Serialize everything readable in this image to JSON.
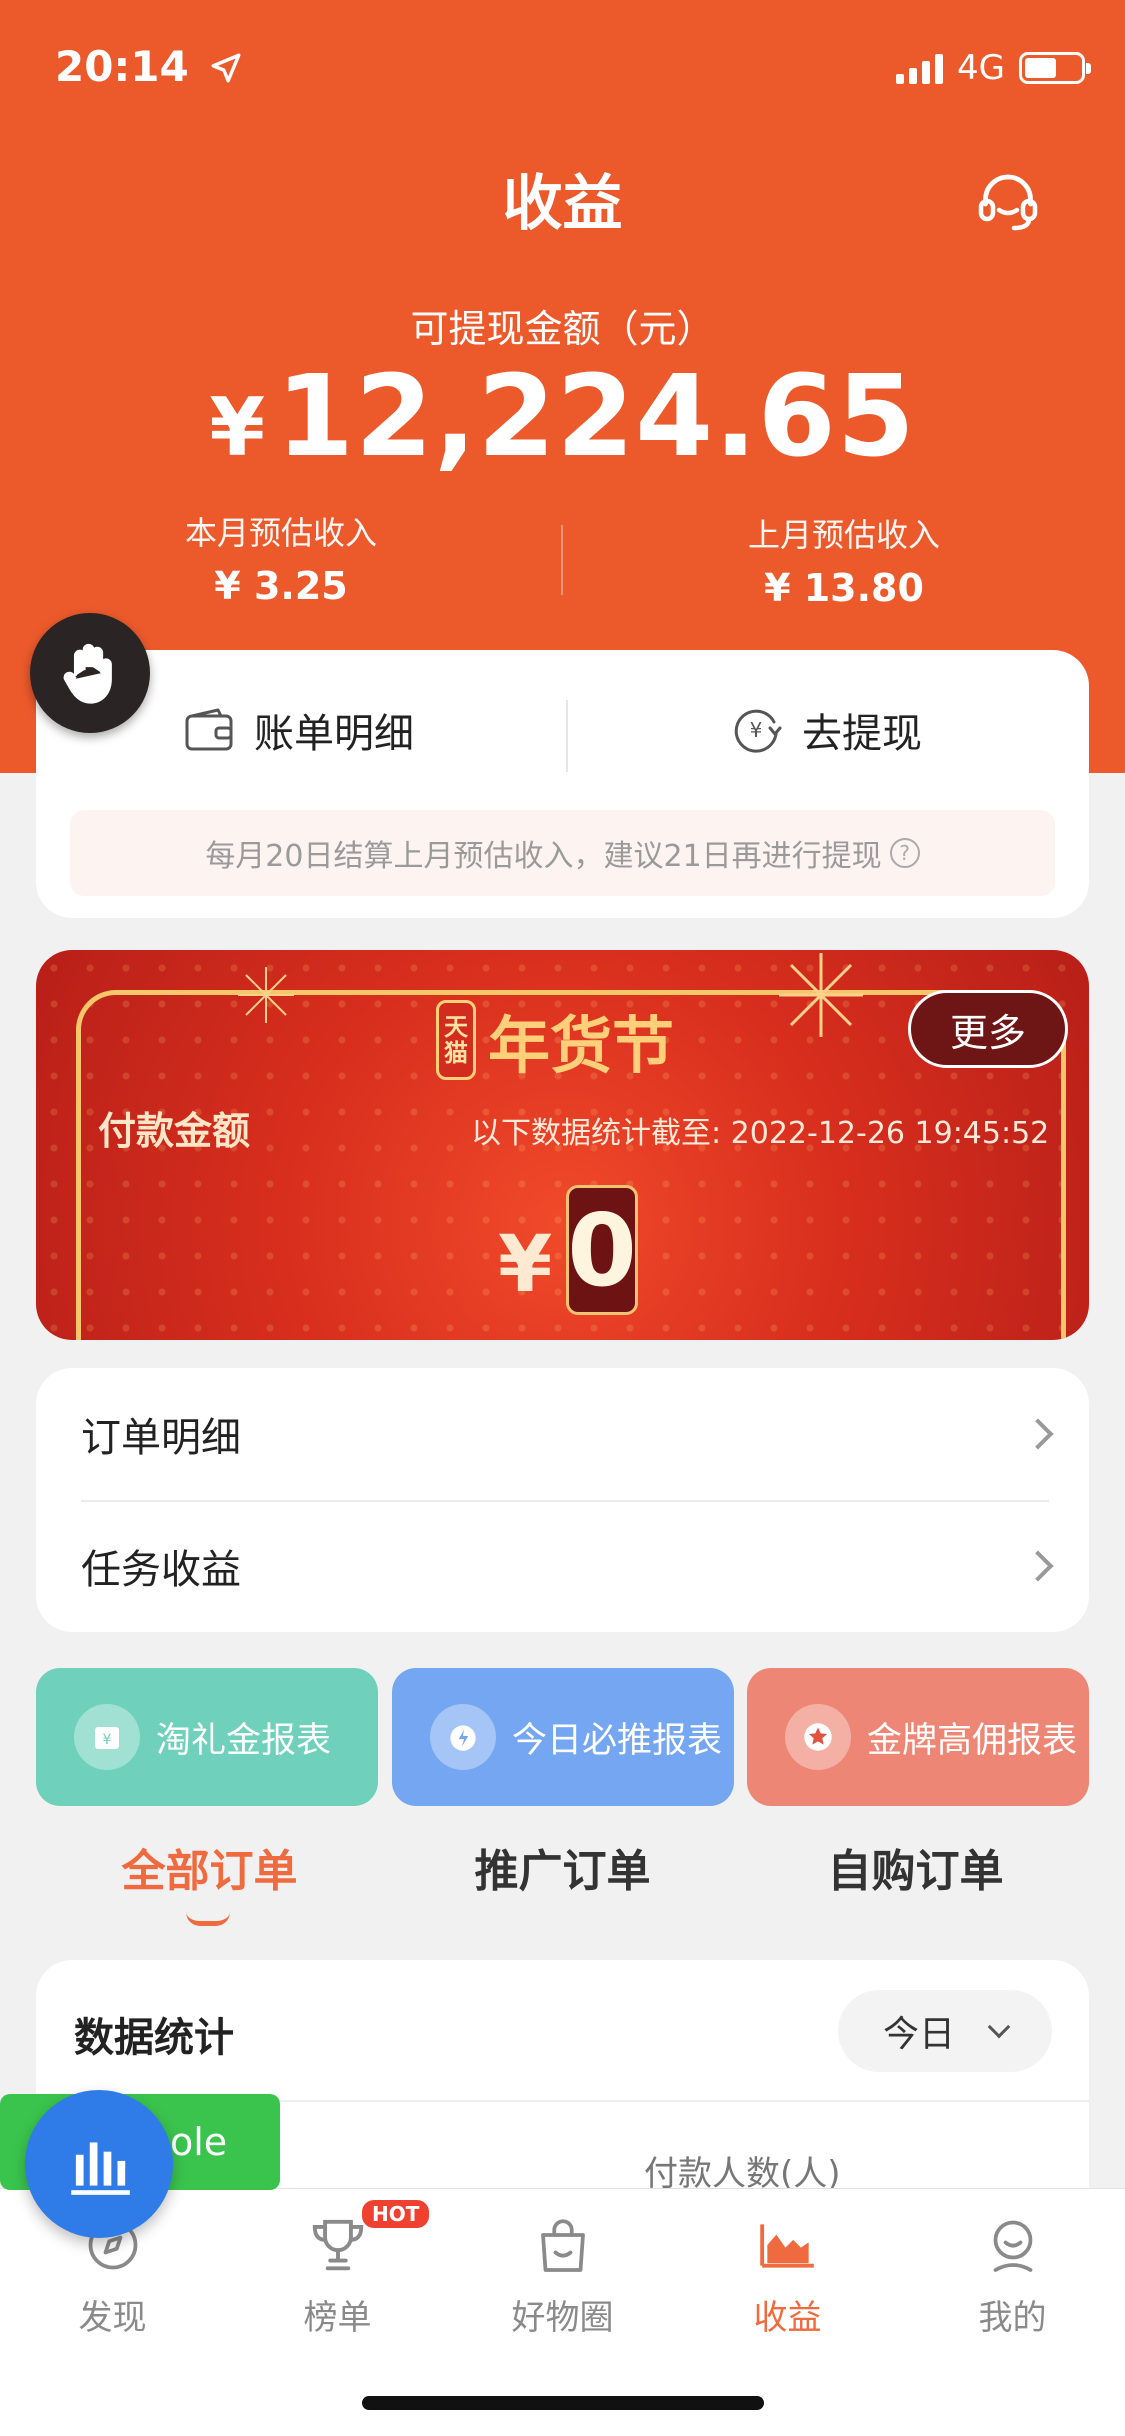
{
  "status": {
    "time": "20:14",
    "network": "4G"
  },
  "header": {
    "title": "收益",
    "balance_label": "可提现金额（元）",
    "balance_currency": "¥",
    "balance_value": "12,224.65",
    "this_month_label": "本月预估收入",
    "this_month_value": "¥ 3.25",
    "last_month_label": "上月预估收入",
    "last_month_value": "¥ 13.80"
  },
  "actions": {
    "bill_label": "账单明细",
    "withdraw_label": "去提现",
    "notice": "每月20日结算上月预估收入，建议21日再进行提现"
  },
  "banner": {
    "badge_top": "天",
    "badge_bottom": "猫",
    "title": "年货节",
    "more_label": "更多",
    "pay_label": "付款金额",
    "data_time": "以下数据统计截至: 2022-12-26 19:45:52",
    "currency": "¥",
    "amount": "0"
  },
  "list": {
    "items": [
      {
        "label": "订单明细"
      },
      {
        "label": "任务收益"
      }
    ]
  },
  "reports": [
    {
      "label": "淘礼金报表",
      "color": "#6fd1bc"
    },
    {
      "label": "今日必推报表",
      "color": "#74a6f2"
    },
    {
      "label": "金牌高佣报表",
      "color": "#ee8675"
    }
  ],
  "order_tabs": [
    {
      "label": "全部订单",
      "active": true
    },
    {
      "label": "推广订单",
      "active": false
    },
    {
      "label": "自购订单",
      "active": false
    }
  ],
  "stats": {
    "title": "数据统计",
    "period": "今日",
    "payers_label": "付款人数(人)"
  },
  "floating": {
    "role_text": "ole"
  },
  "tabbar": {
    "hot_badge": "HOT",
    "items": [
      {
        "label": "发现",
        "icon": "discover-icon"
      },
      {
        "label": "榜单",
        "icon": "trophy-icon"
      },
      {
        "label": "好物圈",
        "icon": "bag-icon"
      },
      {
        "label": "收益",
        "icon": "earnings-chart-icon",
        "active": true
      },
      {
        "label": "我的",
        "icon": "profile-icon"
      }
    ]
  },
  "colors": {
    "brand": "#ec5a2c",
    "accent": "#ef6a3e"
  }
}
